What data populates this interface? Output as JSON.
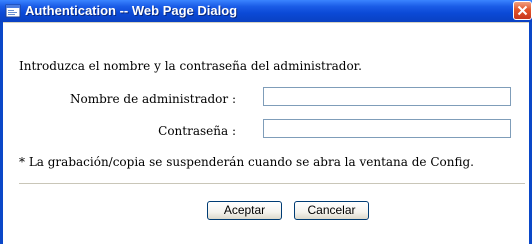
{
  "window": {
    "title": "Authentication -- Web Page Dialog"
  },
  "dialog": {
    "instruction": "Introduzca el nombre y la contraseña del administrador.",
    "admin_label": "Nombre de administrador :",
    "admin_value": "",
    "password_label": "Contraseña :",
    "password_value": "",
    "note": "* La grabación/copia se suspenderán cuando se abra la ventana de Config.",
    "ok_label": "Aceptar",
    "cancel_label": "Cancelar"
  }
}
